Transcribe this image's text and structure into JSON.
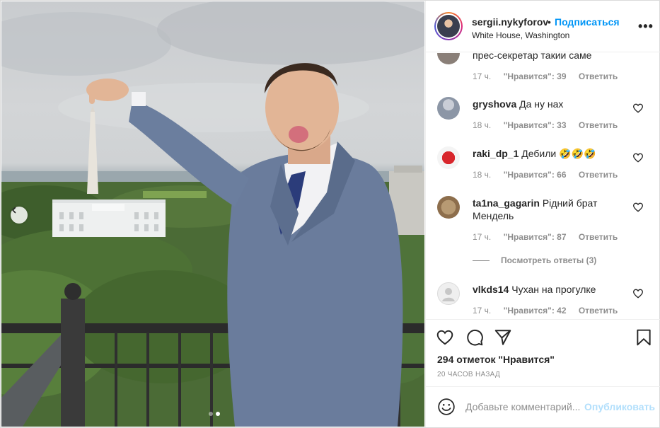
{
  "header": {
    "username": "sergii.nykyforov",
    "separator": "•",
    "follow_label": "Подписаться",
    "location": "White House, Washington"
  },
  "comments": [
    {
      "username": "",
      "text": "прес-секретар такий саме",
      "time": "17 ч.",
      "likes": "\"Нравится\": 39",
      "reply": "Ответить",
      "avatar_color": "#8a7f78"
    },
    {
      "username": "gryshova",
      "text": "Да ну нах",
      "time": "18 ч.",
      "likes": "\"Нравится\": 33",
      "reply": "Ответить",
      "avatar_color": "#9aa3b0"
    },
    {
      "username": "raki_dp_1",
      "text": "Дебили 🤣🤣🤣",
      "time": "18 ч.",
      "likes": "\"Нравится\": 66",
      "reply": "Ответить",
      "avatar_color": "#d8262c"
    },
    {
      "username": "ta1na_gagarin",
      "text": "Рідний брат Мендель",
      "time": "17 ч.",
      "likes": "\"Нравится\": 87",
      "reply": "Ответить",
      "view_replies": "Посмотреть ответы (3)",
      "avatar_color": "#b79a73"
    },
    {
      "username": "vlkds14",
      "text": "Чухан на прогулке",
      "time": "17 ч.",
      "likes": "\"Нравится\": 42",
      "reply": "Ответить",
      "avatar_color": "#dbdbdb"
    }
  ],
  "actions": {
    "likes_count": "294 отметок \"Нравится\"",
    "time_ago": "20 ЧАСОВ НАЗАД"
  },
  "add_comment": {
    "placeholder": "Добавьте комментарий...",
    "publish_label": "Опубликовать"
  },
  "icons": {
    "more": "more-options-icon",
    "like": "heart-icon",
    "comment": "comment-icon",
    "share": "share-icon",
    "save": "bookmark-icon",
    "emoji": "emoji-icon",
    "prev": "chevron-left-icon"
  },
  "colors": {
    "accent": "#0095f6",
    "publish_disabled": "#b2dffc",
    "muted": "#8e8e8e",
    "text": "#262626"
  },
  "carousel": {
    "total_slides": 2,
    "active_slide": 2
  }
}
